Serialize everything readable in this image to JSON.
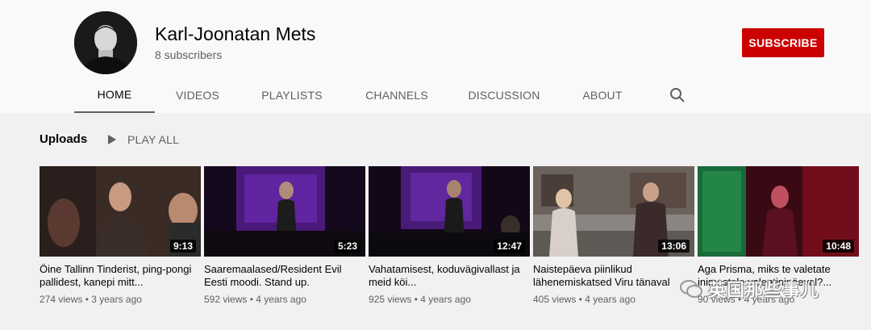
{
  "channel": {
    "name": "Karl-Joonatan Mets",
    "subscribers": "8 subscribers",
    "subscribe_label": "SUBSCRIBE"
  },
  "tabs": [
    {
      "label": "HOME",
      "active": true
    },
    {
      "label": "VIDEOS"
    },
    {
      "label": "PLAYLISTS"
    },
    {
      "label": "CHANNELS"
    },
    {
      "label": "DISCUSSION"
    },
    {
      "label": "ABOUT"
    }
  ],
  "section": {
    "title": "Uploads",
    "play_all": "PLAY ALL"
  },
  "videos": [
    {
      "duration": "9:13",
      "title": "Öine Tallinn Tinderist, ping-pongi pallidest, kanepi mitt...",
      "views": "274 views",
      "age": "3 years ago"
    },
    {
      "duration": "5:23",
      "title": "Saaremaalased/Resident Evil Eesti moodi. Stand up.",
      "views": "592 views",
      "age": "4 years ago"
    },
    {
      "duration": "12:47",
      "title": "Vahatamisest, koduvägivallast ja meid köi...",
      "views": "925 views",
      "age": "4 years ago"
    },
    {
      "duration": "13:06",
      "title": "Naistepäeva piinlikud lähenemiskatsed Viru tänaval",
      "views": "405 views",
      "age": "4 years ago"
    },
    {
      "duration": "10:48",
      "title": "Aga Prisma, miks te valetate inimestele valentinipäeval?...",
      "views": "90 views",
      "age": "4 years ago"
    }
  ],
  "watermark": "英国那些事儿",
  "colors": {
    "subscribe": "#cc0000",
    "page_bg": "#f9f9f9",
    "content_bg": "#f1f1f1",
    "secondary_text": "#606060"
  }
}
